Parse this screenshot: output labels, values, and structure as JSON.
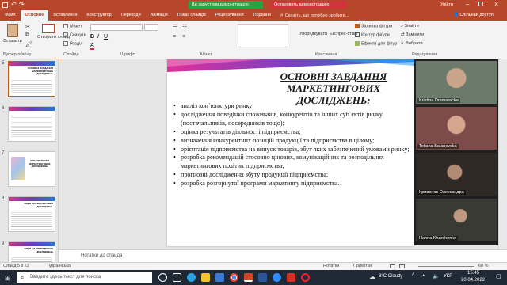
{
  "window": {
    "banner_demo": "Ви запустили демонстрацію екрана",
    "banner_stop": "Остановить демонстрацию",
    "search_placeholder": "Скажіть, що потрібно зробити...",
    "sign_in": "Увійти",
    "share": "Спільний доступ"
  },
  "tabs": [
    "Файл",
    "Основне",
    "Вставлення",
    "Конструктор",
    "Переходи",
    "Анімація",
    "Показ слайдів",
    "Рецензування",
    "Подання"
  ],
  "ribbon": {
    "paste": "Вставити",
    "cut": "Макет",
    "reset": "Скинути",
    "section": "Розділ",
    "new_slide": "Створити слайд",
    "arrange": "Упорядкувати",
    "quick_styles": "Експрес-стилі",
    "shape_fill": "Заливка фігури",
    "shape_outline": "Контур фігури",
    "shape_effects": "Ефекти для фігур",
    "find": "Знайти",
    "replace": "Замінити",
    "select": "Вибрати",
    "groups": {
      "clipboard": "Буфер обміну",
      "slides": "Слайди",
      "font": "Шрифт",
      "paragraph": "Абзац",
      "drawing": "Креслення",
      "editing": "Редагування"
    }
  },
  "thumbnails": [
    {
      "num": "5",
      "title": "ОСНОВНІ ЗАВДАННЯ МАРКЕТИНГОВИХ ДОСЛІДЖЕНЬ"
    },
    {
      "num": "6",
      "title": ""
    },
    {
      "num": "7",
      "title": "ЦІЛЬОВІ РИНКИ МАРКЕТИНГОВИХ ДОСЛІДЖЕНЬ"
    },
    {
      "num": "8",
      "title": "ВИДИ МАРКЕТИНГОВИХ ДОСЛІДЖЕНЬ"
    },
    {
      "num": "9",
      "title": "ВИДИ МАРКЕТИНГОВИХ ДОСЛІДЖЕНЬ"
    }
  ],
  "slide": {
    "title": "Основні завдання маркетингових досліджень:",
    "bullets": [
      "аналіз кон`юнктури ринку;",
      "дослідження поведінки споживачів, конкурентів та інших суб`єктів ринку (постачальників, посередників тощо);",
      "оцінка результатів діяльності підприємства;",
      "визначення конкурентних позицій продукції та підприємства в цілому;",
      "орієнтація підприємства на випуск товарів, збут яких забезпечений умовами ринку;",
      "розробка рекомендацій стосовно цінових, комунікаційних та розподільчих маркетингових політик підприємства;",
      "прогнозні дослідження збуту продукції підприємства;",
      "розробка розгорнутої програми маркетингу підприємства."
    ]
  },
  "participants": [
    {
      "name": "Kristina Dramarecka",
      "color": "#6b7a6a"
    },
    {
      "name": "Tetiana Balanovska",
      "color": "#7d4c4a"
    },
    {
      "name": "Кривонос Олександра",
      "color": "#2f2a26"
    },
    {
      "name": "Hanna Kharchenko",
      "color": "#3a3a35"
    }
  ],
  "notes_placeholder": "Нотатки до слайда",
  "status": {
    "slide_of": "Слайд 5 з 22",
    "language": "українська",
    "notes": "Нотатки",
    "comments": "Примітки",
    "zoom": "68 %"
  },
  "taskbar": {
    "search_placeholder": "Введите здесь текст для поиска",
    "weather": "8°C Cloudy",
    "lang": "УКР",
    "time": "15:45",
    "date": "20.04.2022"
  },
  "colors": {
    "accent": "#b7472a",
    "green": "#2ea043",
    "red": "#d13438"
  }
}
